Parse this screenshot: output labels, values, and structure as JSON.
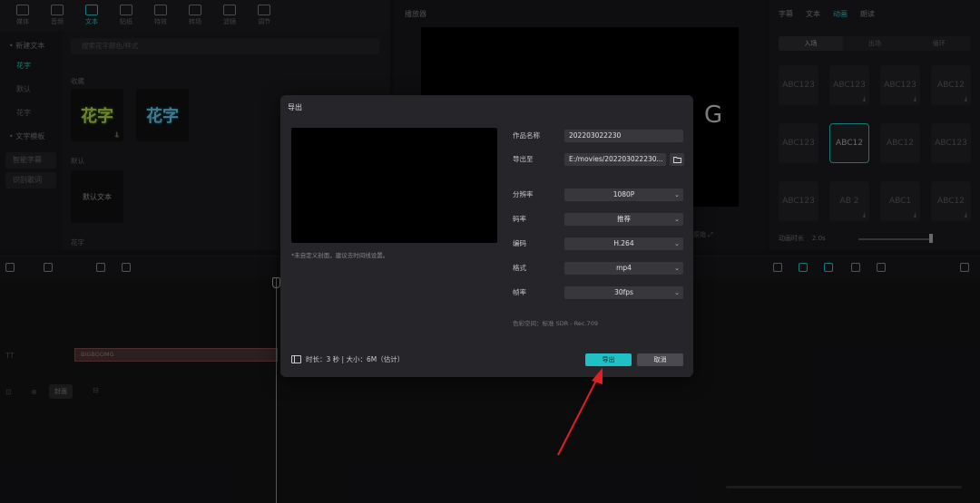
{
  "toolbar": {
    "tools": [
      {
        "label": "媒体",
        "icon": "media-icon",
        "active": false
      },
      {
        "label": "音频",
        "icon": "audio-icon",
        "active": false
      },
      {
        "label": "文本",
        "icon": "text-icon",
        "active": true
      },
      {
        "label": "贴纸",
        "icon": "sticker-icon",
        "active": false
      },
      {
        "label": "特效",
        "icon": "effects-icon",
        "active": false
      },
      {
        "label": "转场",
        "icon": "transition-icon",
        "active": false
      },
      {
        "label": "滤镜",
        "icon": "filter-icon",
        "active": false
      },
      {
        "label": "调节",
        "icon": "adjust-icon",
        "active": false
      }
    ]
  },
  "left_panel": {
    "nav": {
      "new_text": "• 新建文本",
      "fancy": "花字",
      "default": "默认",
      "flower": "花字",
      "text_template": "• 文字模板",
      "smart_subtitle": "智能字幕",
      "recognize_lyrics": "识别歌词"
    },
    "search_placeholder": "搜索花字颜色/样式",
    "section_favorites": "收藏",
    "thumb1": "花字",
    "thumb2": "花字",
    "section_default": "默认",
    "default_text": "默认文本",
    "section_flower": "花字"
  },
  "player": {
    "title": "播放器",
    "overlay_letter": "G",
    "ratio_label": "原始"
  },
  "inspector": {
    "tabs": [
      "字幕",
      "文本",
      "动画",
      "朗读"
    ],
    "active_tab_index": 2,
    "segments": [
      "入场",
      "出场",
      "循环"
    ],
    "active_segment_index": 0,
    "presets": [
      {
        "label": "ABC123",
        "download": false,
        "selected": false
      },
      {
        "label": "ABC123",
        "download": true,
        "selected": false
      },
      {
        "label": "ABC123",
        "download": true,
        "selected": false
      },
      {
        "label": "ABC12",
        "download": true,
        "selected": false
      },
      {
        "label": "ABC123",
        "download": false,
        "selected": false
      },
      {
        "label": "ABC12",
        "download": false,
        "selected": true
      },
      {
        "label": "ABC12",
        "download": false,
        "selected": false
      },
      {
        "label": "ABC123",
        "download": false,
        "selected": false
      },
      {
        "label": "ABC123",
        "download": false,
        "selected": false
      },
      {
        "label": "AB 2",
        "download": true,
        "selected": false
      },
      {
        "label": "ABC1",
        "download": true,
        "selected": false
      },
      {
        "label": "ABC12",
        "download": true,
        "selected": false
      }
    ],
    "duration_label": "动画时长",
    "duration_value": "2.0s"
  },
  "timeline": {
    "clip_label": "BIGBOOMG",
    "cover_label": "封面"
  },
  "export_dialog": {
    "title": "导出",
    "cover_note": "*未自定义封面，建议去时间线设置。",
    "fields": {
      "name_label": "作品名称",
      "name_value": "202203022230",
      "export_to_label": "导出至",
      "export_to_value": "E:/movies/202203022230...",
      "resolution_label": "分辨率",
      "resolution_value": "1080P",
      "bitrate_label": "码率",
      "bitrate_value": "推荐",
      "codec_label": "编码",
      "codec_value": "H.264",
      "format_label": "格式",
      "format_value": "mp4",
      "framerate_label": "帧率",
      "framerate_value": "30fps"
    },
    "color_space": "色彩空间：标准 SDR - Rec.709",
    "footer_info": "时长：3 秒 | 大小：6M（估计）",
    "export_button": "导出",
    "cancel_button": "取消"
  },
  "colors": {
    "accent": "#21c3c0",
    "export_button": "#1fc1c6",
    "annotation_arrow": "#e02020"
  }
}
